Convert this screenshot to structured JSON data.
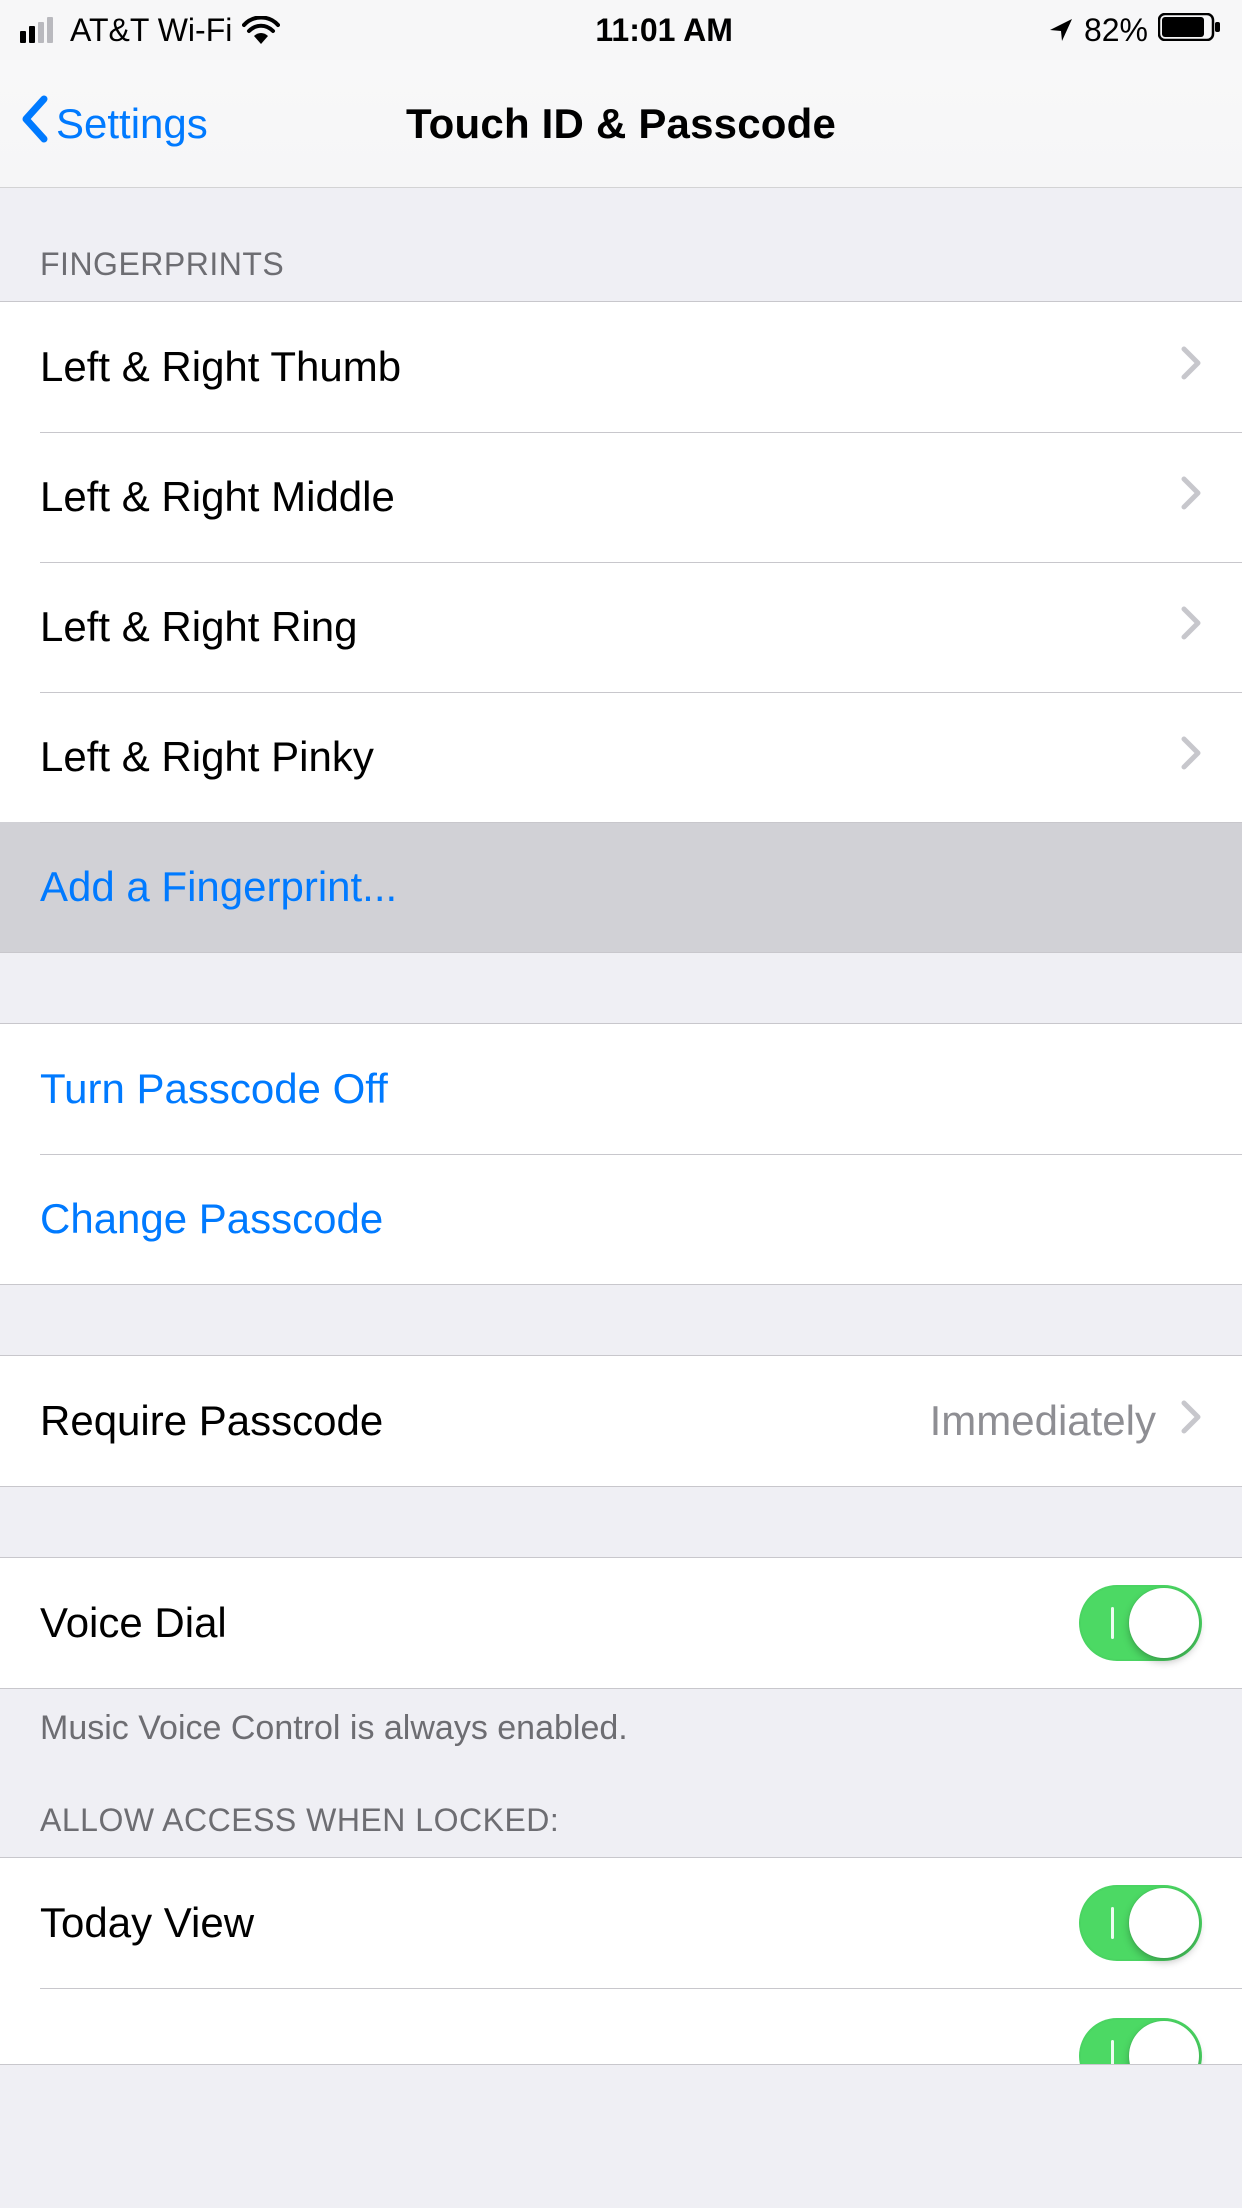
{
  "status": {
    "carrier": "AT&T Wi-Fi",
    "time": "11:01 AM",
    "battery_pct": "82%"
  },
  "nav": {
    "back_label": "Settings",
    "title": "Touch ID & Passcode"
  },
  "sections": {
    "fingerprints_header": "FINGERPRINTS",
    "fingerprints": [
      "Left & Right Thumb",
      "Left & Right Middle",
      "Left & Right Ring",
      "Left & Right Pinky"
    ],
    "add_fingerprint": "Add a Fingerprint...",
    "turn_off": "Turn Passcode Off",
    "change": "Change Passcode",
    "require_label": "Require Passcode",
    "require_value": "Immediately",
    "voice_dial": "Voice Dial",
    "voice_footer": "Music Voice Control is always enabled.",
    "locked_header": "ALLOW ACCESS WHEN LOCKED:",
    "today_view": "Today View"
  }
}
